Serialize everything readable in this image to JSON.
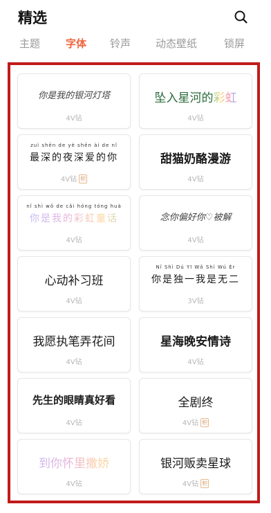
{
  "header": {
    "title": "精选"
  },
  "tabs": [
    {
      "label": "主题",
      "active": false
    },
    {
      "label": "字体",
      "active": true
    },
    {
      "label": "铃声",
      "active": false
    },
    {
      "label": "动态壁纸",
      "active": false
    },
    {
      "label": "锁屏",
      "active": false
    }
  ],
  "colors": {
    "accent": "#f0643c",
    "highlight_frame": "#c21a1a"
  },
  "fonts": [
    {
      "text": "你是我的银河灯塔",
      "pinyin": "",
      "price": "4V钻",
      "badge": ""
    },
    {
      "text": "坠入星河的",
      "text_highlight": "彩虹",
      "pinyin": "",
      "price": "4V钻",
      "badge": ""
    },
    {
      "text": "最深的夜深爱的你",
      "pinyin": "zuì shēn de yè shēn ài de nǐ",
      "price": "4V钻",
      "badge": "积"
    },
    {
      "text": "甜猫奶酪漫游",
      "pinyin": "",
      "price": "4V钻",
      "badge": ""
    },
    {
      "text": "你是我的彩虹童话",
      "pinyin": "nǐ shì wǒ de cǎi hóng tóng huà",
      "price": "4V钻",
      "badge": ""
    },
    {
      "text": "念你偏好你♡被解",
      "pinyin": "",
      "price": "4V钻",
      "badge": ""
    },
    {
      "text": "心动补习班",
      "pinyin": "",
      "price": "4V钻",
      "badge": ""
    },
    {
      "text": "你是独一我是无二",
      "pinyin": "Nǐ Shì Dú Yī Wǒ Shì Wú Èr",
      "price": "3V钻",
      "badge": ""
    },
    {
      "text": "我愿执笔弄花间",
      "pinyin": "",
      "price": "4V钻",
      "badge": ""
    },
    {
      "text": "星海晚安情诗",
      "pinyin": "",
      "price": "4V钻",
      "badge": ""
    },
    {
      "text": "先生的眼睛真好看",
      "pinyin": "",
      "price": "4V钻",
      "badge": ""
    },
    {
      "text": "全剧终",
      "pinyin": "",
      "price": "4V钻",
      "badge": "积"
    },
    {
      "text": "到你怀里撒娇",
      "pinyin": "",
      "price": "4V钻",
      "badge": ""
    },
    {
      "text": "银河贩卖星球",
      "pinyin": "",
      "price": "4V钻",
      "badge": "积"
    }
  ]
}
